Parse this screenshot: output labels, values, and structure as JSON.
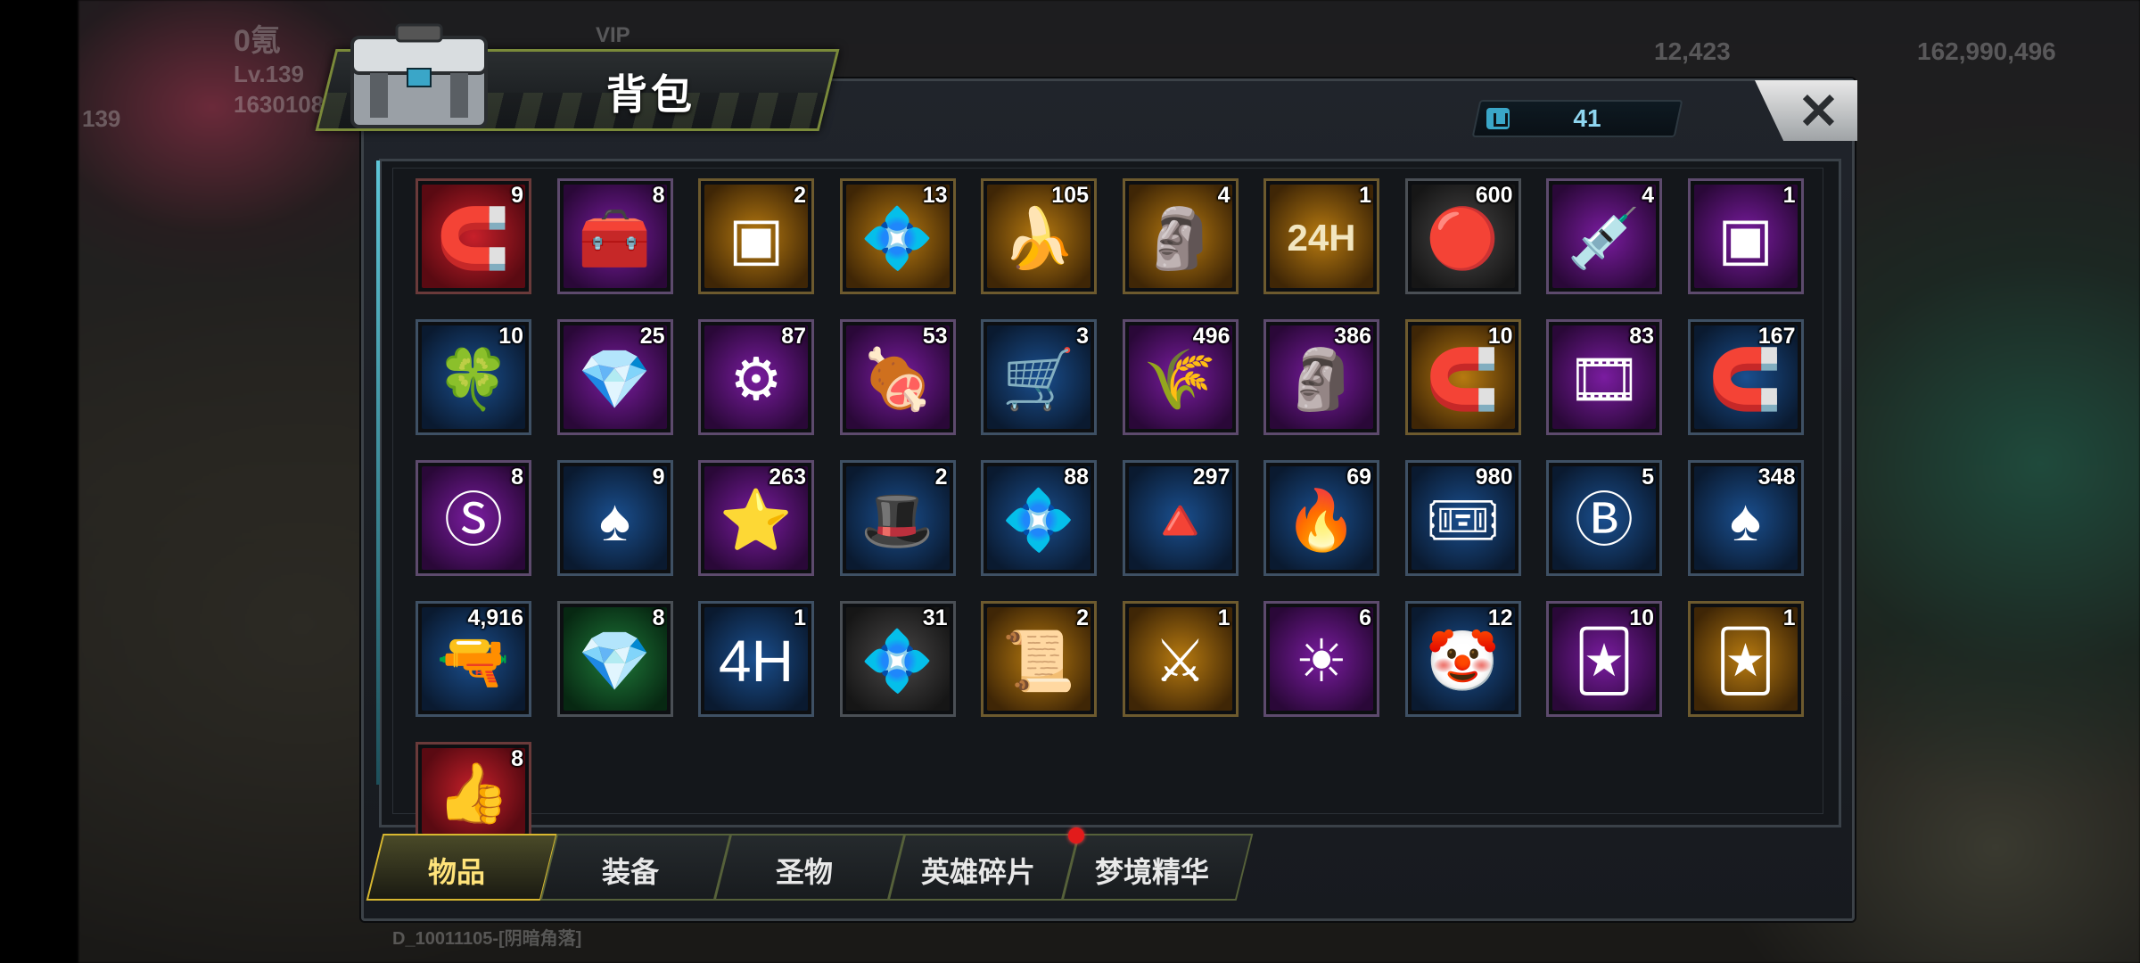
{
  "window": {
    "title": "背包"
  },
  "background": {
    "player_name": "0氪",
    "player_level": "Lv.139",
    "player_id": "1630108",
    "avatar_level": "139",
    "resource_1": "12,423",
    "resource_2": "162,990,496",
    "vip_label": "VIP",
    "footer_text": "D_10011105-[阴暗角落]"
  },
  "counter": {
    "value": "41",
    "icon": "bag-capacity-icon"
  },
  "close": {
    "label": "✕"
  },
  "items": [
    {
      "name": "red-magnet-horn",
      "count": "9",
      "rarity": "red",
      "glyph": "🧲"
    },
    {
      "name": "purple-gem-chest",
      "count": "8",
      "rarity": "purple",
      "glyph": "🧰"
    },
    {
      "name": "hollow-cube",
      "count": "2",
      "rarity": "gold",
      "glyph": "▣"
    },
    {
      "name": "gold-shard",
      "count": "13",
      "rarity": "gold",
      "glyph": "💠"
    },
    {
      "name": "golden-banana",
      "count": "105",
      "rarity": "gold",
      "glyph": "🍌"
    },
    {
      "name": "gold-moai",
      "count": "4",
      "rarity": "gold",
      "glyph": "🗿"
    },
    {
      "name": "speedup-24h-card",
      "count": "1",
      "rarity": "gold",
      "glyph": "24H"
    },
    {
      "name": "neon-bottle-cap",
      "count": "600",
      "rarity": "gray",
      "glyph": "🔴"
    },
    {
      "name": "syringe",
      "count": "4",
      "rarity": "purple",
      "glyph": "💉"
    },
    {
      "name": "purple-cube",
      "count": "1",
      "rarity": "purple",
      "glyph": "▣"
    },
    {
      "name": "clover-coin",
      "count": "10",
      "rarity": "blue",
      "glyph": "🍀"
    },
    {
      "name": "purple-shard",
      "count": "25",
      "rarity": "purple",
      "glyph": "💎"
    },
    {
      "name": "steel-gear-badge",
      "count": "87",
      "rarity": "purple",
      "glyph": "⚙"
    },
    {
      "name": "ham-leg",
      "count": "53",
      "rarity": "purple",
      "glyph": "🍖"
    },
    {
      "name": "ore-cart",
      "count": "3",
      "rarity": "blue",
      "glyph": "🛒"
    },
    {
      "name": "wheat-bundle",
      "count": "496",
      "rarity": "purple",
      "glyph": "🌾"
    },
    {
      "name": "dark-moai",
      "count": "386",
      "rarity": "purple",
      "glyph": "🗿"
    },
    {
      "name": "gold-magnet-horn",
      "count": "10",
      "rarity": "gold",
      "glyph": "🧲"
    },
    {
      "name": "film-reel",
      "count": "83",
      "rarity": "purple",
      "glyph": "🎞"
    },
    {
      "name": "blue-magnet-horn",
      "count": "167",
      "rarity": "blue",
      "glyph": "🧲"
    },
    {
      "name": "s-bottle-cap",
      "count": "8",
      "rarity": "purple",
      "glyph": "Ⓢ"
    },
    {
      "name": "spade-chip",
      "count": "9",
      "rarity": "blue",
      "glyph": "♠"
    },
    {
      "name": "police-star-badge",
      "count": "263",
      "rarity": "purple",
      "glyph": "⭐"
    },
    {
      "name": "green-fedora",
      "count": "2",
      "rarity": "blue",
      "glyph": "🎩"
    },
    {
      "name": "blue-shard",
      "count": "88",
      "rarity": "blue",
      "glyph": "💠"
    },
    {
      "name": "pyramid",
      "count": "297",
      "rarity": "blue",
      "glyph": "🔺"
    },
    {
      "name": "flame-crystal",
      "count": "69",
      "rarity": "blue",
      "glyph": "🔥"
    },
    {
      "name": "cinema-ticket",
      "count": "980",
      "rarity": "blue",
      "glyph": "🎟"
    },
    {
      "name": "b-bottle-cap",
      "count": "5",
      "rarity": "blue",
      "glyph": "Ⓑ"
    },
    {
      "name": "spade-chip-red",
      "count": "348",
      "rarity": "blue",
      "glyph": "♠"
    },
    {
      "name": "bullet",
      "count": "4,916",
      "rarity": "blue",
      "glyph": "🔫"
    },
    {
      "name": "green-shard",
      "count": "8",
      "rarity": "green",
      "glyph": "💎"
    },
    {
      "name": "speedup-4h-card",
      "count": "1",
      "rarity": "blue",
      "glyph": "4H"
    },
    {
      "name": "gray-shard",
      "count": "31",
      "rarity": "gray",
      "glyph": "💠"
    },
    {
      "name": "revolver-blueprint",
      "count": "2",
      "rarity": "gold",
      "glyph": "📜"
    },
    {
      "name": "sword-blueprint",
      "count": "1",
      "rarity": "gold",
      "glyph": "⚔"
    },
    {
      "name": "sun-orb",
      "count": "6",
      "rarity": "purple",
      "glyph": "☀"
    },
    {
      "name": "clown-mask",
      "count": "12",
      "rarity": "blue",
      "glyph": "🤡"
    },
    {
      "name": "jester-mask-purple",
      "count": "10",
      "rarity": "purple",
      "glyph": "🃏"
    },
    {
      "name": "jester-mask-gold",
      "count": "1",
      "rarity": "gold",
      "glyph": "🃏"
    },
    {
      "name": "thumbs-up",
      "count": "8",
      "rarity": "red",
      "glyph": "👍"
    }
  ],
  "tabs": [
    {
      "label": "物品",
      "active": true
    },
    {
      "label": "装备",
      "active": false
    },
    {
      "label": "圣物",
      "active": false
    },
    {
      "label": "英雄碎片",
      "active": false,
      "badge": true
    },
    {
      "label": "梦境精华",
      "active": false
    }
  ],
  "colors": {
    "accent": "#d8b830",
    "counter_text": "#8fd6f0",
    "badge": "#e21b1b"
  }
}
